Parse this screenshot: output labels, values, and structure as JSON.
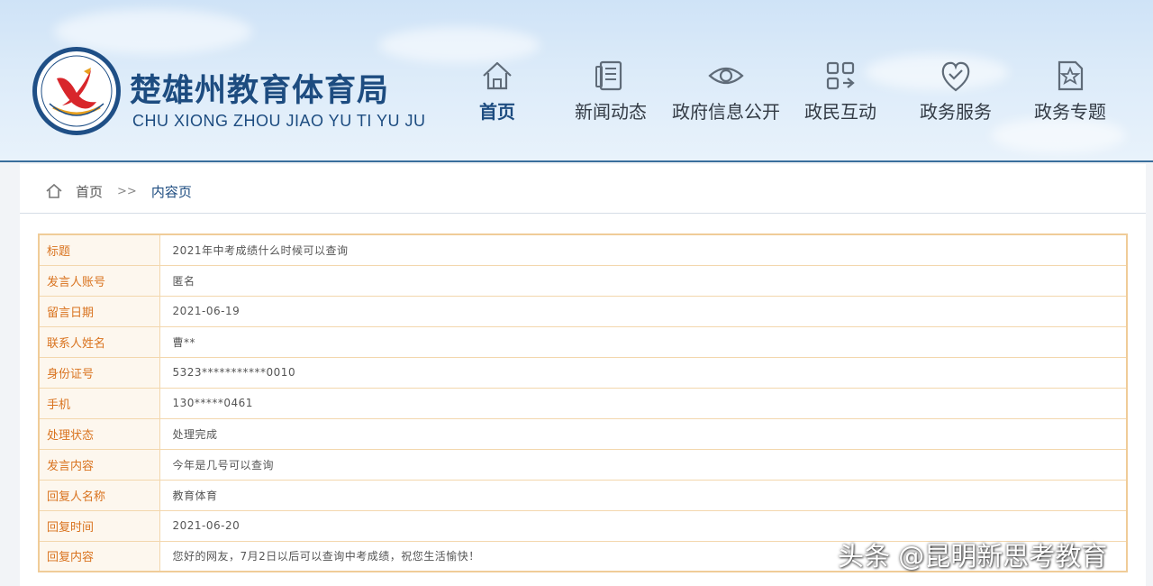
{
  "header": {
    "site_title": "楚雄州教育体育局",
    "site_subtitle": "CHU XIONG ZHOU JIAO YU TI YU JU"
  },
  "nav": {
    "items": [
      {
        "label": "首页",
        "icon": "home-icon"
      },
      {
        "label": "新闻动态",
        "icon": "newspaper-icon"
      },
      {
        "label": "政府信息公开",
        "icon": "eye-icon"
      },
      {
        "label": "政民互动",
        "icon": "interaction-icon"
      },
      {
        "label": "政务服务",
        "icon": "heart-shield-icon"
      },
      {
        "label": "政务专题",
        "icon": "star-document-icon"
      }
    ]
  },
  "breadcrumb": {
    "home": "首页",
    "separator": ">>",
    "current": "内容页"
  },
  "detail": {
    "rows": [
      {
        "label": "标题",
        "value": "2021年中考成绩什么时候可以查询"
      },
      {
        "label": "发言人账号",
        "value": "匿名"
      },
      {
        "label": "留言日期",
        "value": "2021-06-19"
      },
      {
        "label": "联系人姓名",
        "value": "曹**"
      },
      {
        "label": "身份证号",
        "value": "5323***********0010"
      },
      {
        "label": "手机",
        "value": "130*****0461"
      },
      {
        "label": "处理状态",
        "value": "处理完成"
      },
      {
        "label": "发言内容",
        "value": "今年是几号可以查询"
      },
      {
        "label": "回复人名称",
        "value": "教育体育"
      },
      {
        "label": "回复时间",
        "value": "2021-06-20"
      },
      {
        "label": "回复内容",
        "value": "您好的网友，7月2日以后可以查询中考成绩，祝您生活愉快！"
      }
    ]
  },
  "watermark": "头条 @昆明新思考教育",
  "colors": {
    "brand_blue": "#1d4c80",
    "label_orange": "#d9731f",
    "table_border": "#f0cc98",
    "label_bg": "#fdf7ee",
    "logo_red": "#d8262b"
  }
}
